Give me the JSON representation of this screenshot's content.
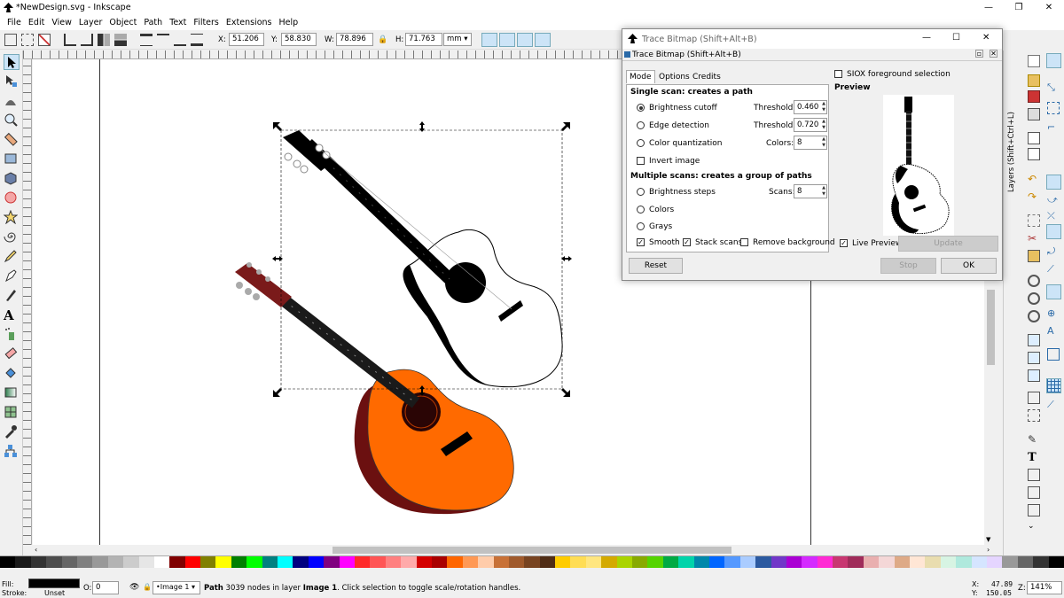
{
  "window": {
    "title": "*NewDesign.svg - Inkscape"
  },
  "menu": [
    "File",
    "Edit",
    "View",
    "Layer",
    "Object",
    "Path",
    "Text",
    "Filters",
    "Extensions",
    "Help"
  ],
  "toolbar": {
    "x_label": "X:",
    "x_value": "51.206",
    "y_label": "Y:",
    "y_value": "58.830",
    "w_label": "W:",
    "w_value": "78.896",
    "h_label": "H:",
    "h_value": "71.763",
    "unit": "mm"
  },
  "layers_tab": "Layers (Shift+Ctrl+L)",
  "dialog": {
    "window_title": "Trace Bitmap (Shift+Alt+B)",
    "inner_title": "Trace Bitmap (Shift+Alt+B)",
    "tabs": [
      "Mode",
      "Options",
      "Credits"
    ],
    "single_scan_heading": "Single scan: creates a path",
    "brightness_cutoff": "Brightness cutoff",
    "edge_detection": "Edge detection",
    "color_quantization": "Color quantization",
    "invert_image": "Invert image",
    "threshold_label": "Threshold:",
    "threshold1": "0.460",
    "threshold2": "0.720",
    "colors_label": "Colors:",
    "colors_value": "8",
    "multiple_scans_heading": "Multiple scans: creates a group of paths",
    "brightness_steps": "Brightness steps",
    "colors": "Colors",
    "grays": "Grays",
    "scans_label": "Scans:",
    "scans_value": "8",
    "smooth": "Smooth",
    "stack_scans": "Stack scans",
    "remove_background": "Remove background",
    "siox": "SIOX foreground selection",
    "preview_heading": "Preview",
    "live_preview": "Live Preview",
    "update": "Update",
    "reset": "Reset",
    "stop": "Stop",
    "ok": "OK"
  },
  "status": {
    "fill_label": "Fill:",
    "stroke_label": "Stroke:",
    "stroke_value": "Unset",
    "opacity_label": "O:",
    "opacity_value": "0",
    "layer": "•Image 1",
    "message_bold": "Path",
    "message": " 3039 nodes in layer ",
    "message_layer": "Image 1",
    "message_tail": ". Click selection to toggle scale/rotation handles.",
    "x_label": "X:",
    "x_value": "47.89",
    "y_label": "Y:",
    "y_value": "150.05",
    "zoom_label": "Z:",
    "zoom_value": "141%"
  },
  "palette": [
    "#000000",
    "#1a1a1a",
    "#333333",
    "#4d4d4d",
    "#666666",
    "#808080",
    "#999999",
    "#b3b3b3",
    "#cccccc",
    "#e6e6e6",
    "#ffffff",
    "#800000",
    "#ff0000",
    "#808000",
    "#ffff00",
    "#008000",
    "#00ff00",
    "#008080",
    "#00ffff",
    "#000080",
    "#0000ff",
    "#800080",
    "#ff00ff",
    "#ff2a2a",
    "#ff5555",
    "#ff8080",
    "#ffaaaa",
    "#d40000",
    "#aa0000",
    "#ff6600",
    "#ff9955",
    "#ffccaa",
    "#c87137",
    "#a05a2c",
    "#784421",
    "#502d16",
    "#ffcc00",
    "#ffdd55",
    "#ffe680",
    "#d4aa00",
    "#aad400",
    "#88aa00",
    "#55d400",
    "#00aa44",
    "#00d4aa",
    "#0088aa",
    "#0066ff",
    "#5599ff",
    "#aaccff",
    "#2c5aa0",
    "#7137c8",
    "#aa00d4",
    "#d42aff",
    "#ff2ad4",
    "#c83771",
    "#a02c5a",
    "#e9afaf",
    "#f4d7d7",
    "#deaa87",
    "#ffe6d5",
    "#e9ddaf",
    "#d7f4e3",
    "#afe9dd",
    "#d5e5ff",
    "#e5d5ff",
    "#999999",
    "#666666",
    "#333333",
    "#000000"
  ]
}
